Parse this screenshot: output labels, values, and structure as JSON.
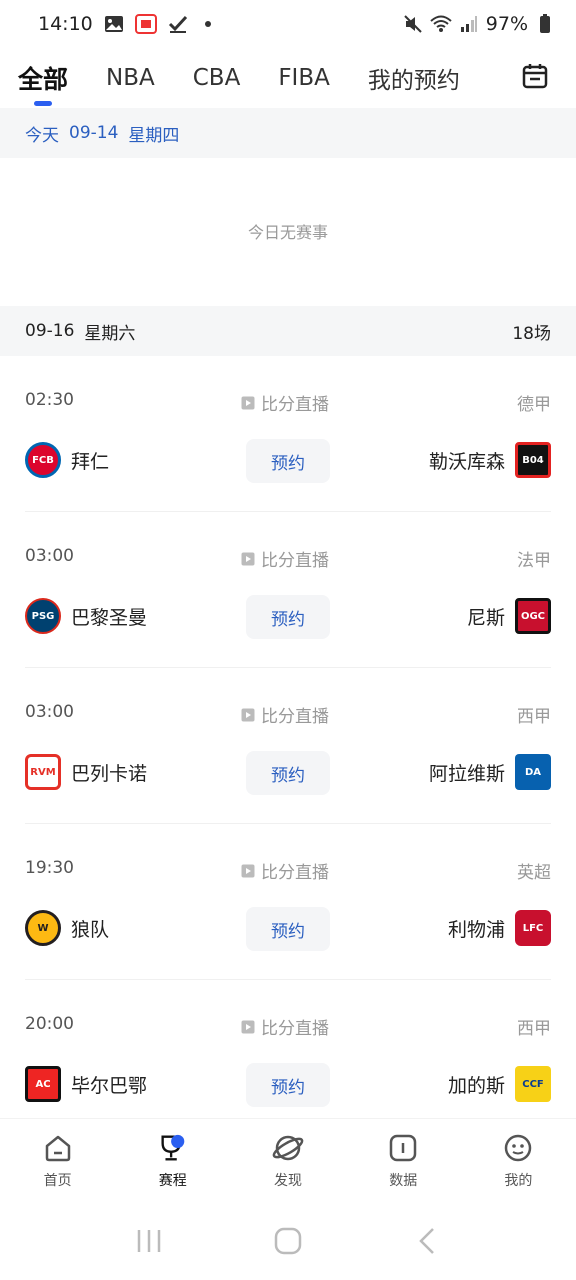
{
  "status": {
    "time": "14:10",
    "battery": "97%"
  },
  "tabs": [
    {
      "label": "全部",
      "active": true
    },
    {
      "label": "NBA",
      "active": false
    },
    {
      "label": "CBA",
      "active": false
    },
    {
      "label": "FIBA",
      "active": false
    },
    {
      "label": "我的预约",
      "active": false
    }
  ],
  "today": {
    "label": "今天",
    "date": "09-14",
    "weekday": "星期四",
    "empty_text": "今日无赛事"
  },
  "section": {
    "date": "09-16",
    "weekday": "星期六",
    "count": "18场"
  },
  "matches": [
    {
      "time": "02:30",
      "live_label": "比分直播",
      "league": "德甲",
      "home": "拜仁",
      "away": "勒沃库森",
      "book": "预约",
      "home_color": "#dc052d",
      "away_color": "#e32221"
    },
    {
      "time": "03:00",
      "live_label": "比分直播",
      "league": "法甲",
      "home": "巴黎圣曼",
      "away": "尼斯",
      "book": "预约",
      "home_color": "#004170",
      "away_color": "#c8102e"
    },
    {
      "time": "03:00",
      "live_label": "比分直播",
      "league": "西甲",
      "home": "巴列卡诺",
      "away": "阿拉维斯",
      "book": "预约",
      "home_color": "#e53027",
      "away_color": "#0761af"
    },
    {
      "time": "19:30",
      "live_label": "比分直播",
      "league": "英超",
      "home": "狼队",
      "away": "利物浦",
      "book": "预约",
      "home_color": "#fdb913",
      "away_color": "#c8102e"
    },
    {
      "time": "20:00",
      "live_label": "比分直播",
      "league": "西甲",
      "home": "毕尔巴鄂",
      "away": "加的斯",
      "book": "预约",
      "home_color": "#ee2523",
      "away_color": "#f7d117"
    }
  ],
  "bottom_nav": [
    {
      "label": "首页",
      "icon": "home-icon"
    },
    {
      "label": "赛程",
      "icon": "trophy-icon",
      "active": true
    },
    {
      "label": "发现",
      "icon": "planet-icon"
    },
    {
      "label": "数据",
      "icon": "data-icon"
    },
    {
      "label": "我的",
      "icon": "profile-icon"
    }
  ]
}
